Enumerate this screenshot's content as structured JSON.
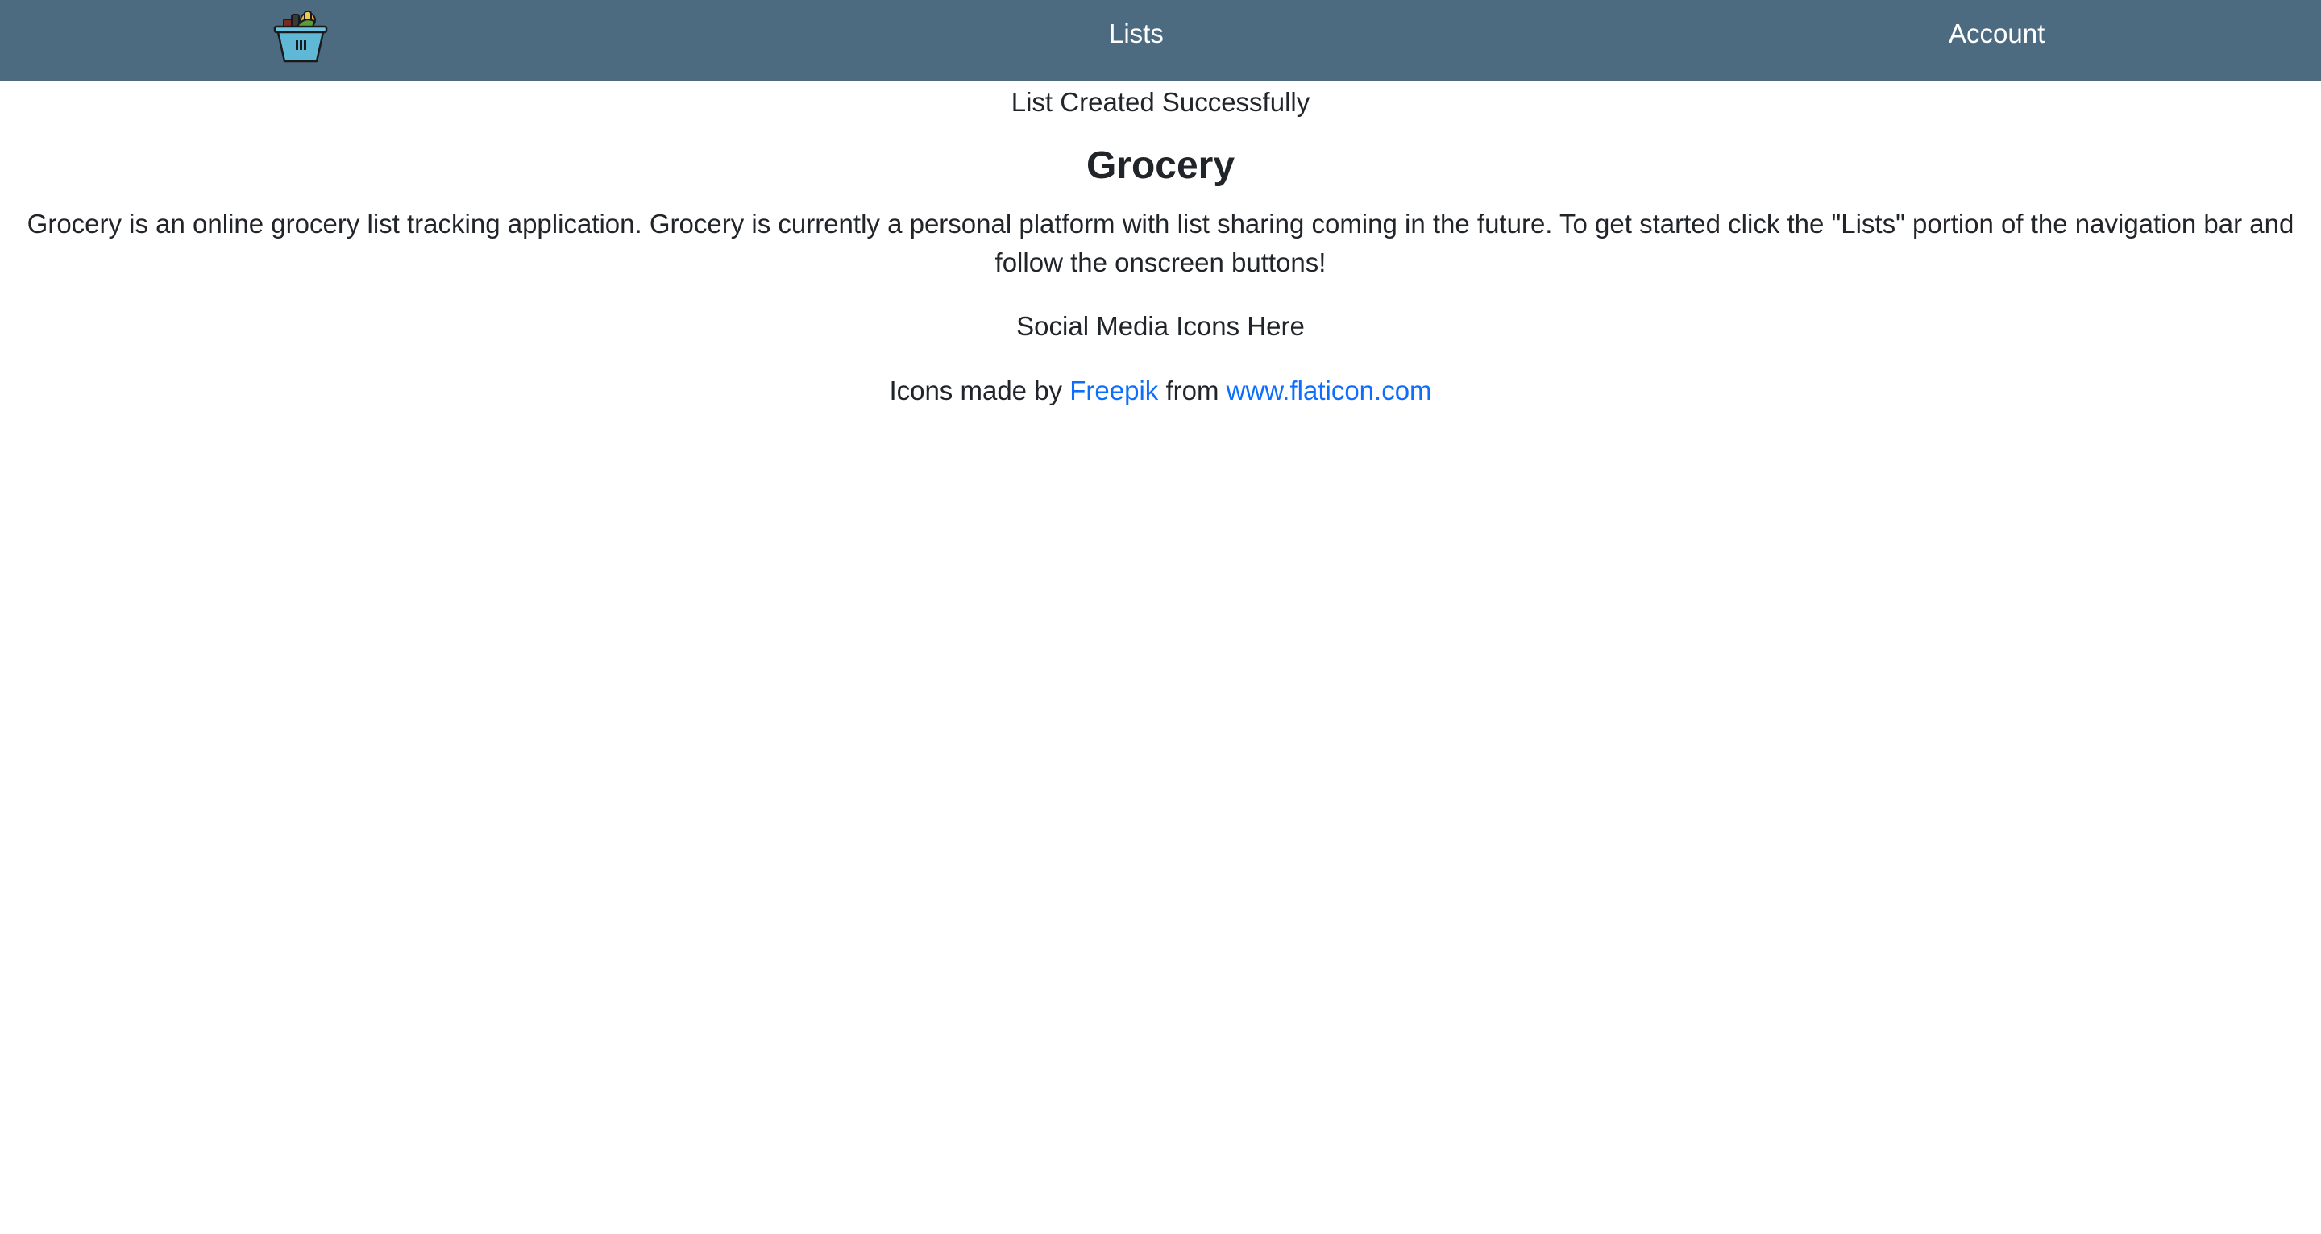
{
  "navbar": {
    "logo_icon": "grocery-basket-icon",
    "links": [
      {
        "label": "Lists"
      },
      {
        "label": "Account"
      }
    ],
    "background": "#4c6a80"
  },
  "main": {
    "flash_message": "List Created Successfully",
    "title": "Grocery",
    "description": "Grocery is an online grocery list tracking application. Grocery is currently a personal platform with list sharing coming in the future. To get started click the \"Lists\" portion of the navigation bar and follow the onscreen buttons!",
    "social_placeholder": "Social Media Icons Here",
    "credits": {
      "prefix": "Icons made by",
      "author_link": "Freepik",
      "middle": "from",
      "site_link": "www.flaticon.com"
    }
  },
  "colors": {
    "link": "#0d6efd",
    "text": "#212529"
  }
}
